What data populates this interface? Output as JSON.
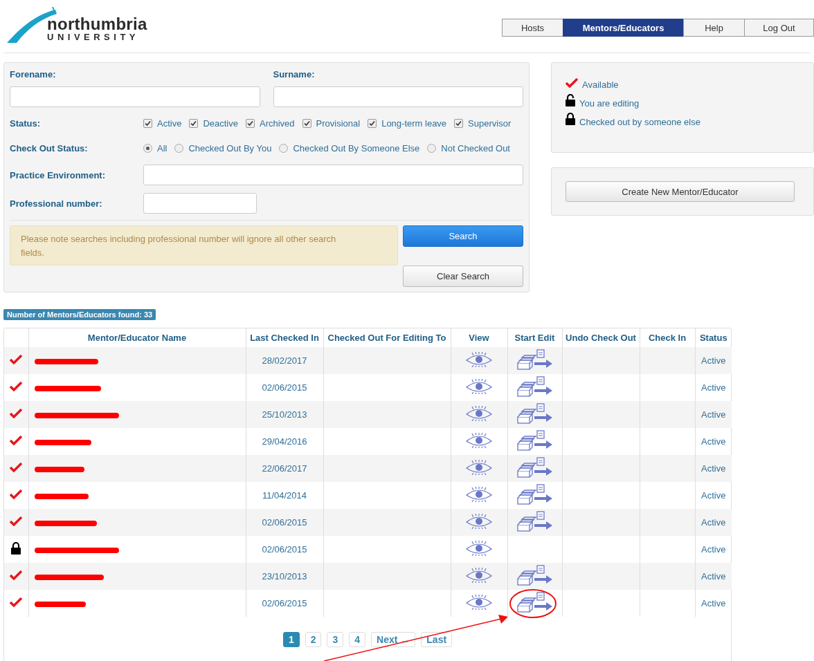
{
  "logo": {
    "name": "northumbria",
    "subtitle": "UNIVERSITY"
  },
  "nav": [
    {
      "label": "Hosts",
      "selected": false
    },
    {
      "label": "Mentors/Educators",
      "selected": true
    },
    {
      "label": "Help",
      "selected": false
    },
    {
      "label": "Log Out",
      "selected": false
    }
  ],
  "search": {
    "forename_label": "Forename:",
    "surname_label": "Surname:",
    "status_label": "Status:",
    "status_options": [
      {
        "label": "Active",
        "checked": true
      },
      {
        "label": "Deactive",
        "checked": true
      },
      {
        "label": "Archived",
        "checked": true
      },
      {
        "label": "Provisional",
        "checked": true
      },
      {
        "label": "Long-term leave",
        "checked": true
      },
      {
        "label": "Supervisor",
        "checked": true
      }
    ],
    "checkout_label": "Check Out Status:",
    "checkout_options": [
      {
        "label": "All",
        "selected": true
      },
      {
        "label": "Checked Out By You",
        "selected": false
      },
      {
        "label": "Checked Out By Someone Else",
        "selected": false
      },
      {
        "label": "Not Checked Out",
        "selected": false
      }
    ],
    "practice_label": "Practice Environment:",
    "professional_label": "Professional number:",
    "note": "Please note searches including professional number will ignore all other search fields.",
    "search_button": "Search",
    "clear_button": "Clear Search"
  },
  "legend": [
    {
      "kind": "available",
      "label": "Available"
    },
    {
      "kind": "editing",
      "label": "You are editing"
    },
    {
      "kind": "locked",
      "label": "Checked out by someone else"
    }
  ],
  "create_button": "Create New Mentor/Educator",
  "count_badge": "Number of Mentors/Educators found: 33",
  "table": {
    "columns": [
      "",
      "Mentor/Educator Name",
      "Last Checked In",
      "Checked Out For Editing To",
      "View",
      "Start Edit",
      "Undo Check Out",
      "Check In",
      "Status"
    ],
    "rows": [
      {
        "kind": "available",
        "redacted": true,
        "last_checked_in": "28/02/2017",
        "can_edit": true,
        "status": "Active",
        "annotated": false
      },
      {
        "kind": "available",
        "redacted": true,
        "last_checked_in": "02/06/2015",
        "can_edit": true,
        "status": "Active",
        "annotated": false
      },
      {
        "kind": "available",
        "redacted": true,
        "last_checked_in": "25/10/2013",
        "can_edit": true,
        "status": "Active",
        "annotated": false
      },
      {
        "kind": "available",
        "redacted": true,
        "last_checked_in": "29/04/2016",
        "can_edit": true,
        "status": "Active",
        "annotated": false
      },
      {
        "kind": "available",
        "redacted": true,
        "last_checked_in": "22/06/2017",
        "can_edit": true,
        "status": "Active",
        "annotated": false
      },
      {
        "kind": "available",
        "redacted": true,
        "last_checked_in": "11/04/2014",
        "can_edit": true,
        "status": "Active",
        "annotated": false
      },
      {
        "kind": "available",
        "redacted": true,
        "last_checked_in": "02/06/2015",
        "can_edit": true,
        "status": "Active",
        "annotated": false
      },
      {
        "kind": "locked",
        "redacted": true,
        "last_checked_in": "02/06/2015",
        "can_edit": false,
        "status": "Active",
        "annotated": false
      },
      {
        "kind": "available",
        "redacted": true,
        "last_checked_in": "23/10/2013",
        "can_edit": true,
        "status": "Active",
        "annotated": false
      },
      {
        "kind": "available",
        "redacted": true,
        "last_checked_in": "02/06/2015",
        "can_edit": true,
        "status": "Active",
        "annotated": true
      }
    ]
  },
  "pagination": {
    "pages": [
      {
        "label": "1",
        "selected": true
      },
      {
        "label": "2",
        "selected": false
      },
      {
        "label": "3",
        "selected": false
      },
      {
        "label": "4",
        "selected": false
      }
    ],
    "next": "Next →",
    "last": "Last"
  }
}
